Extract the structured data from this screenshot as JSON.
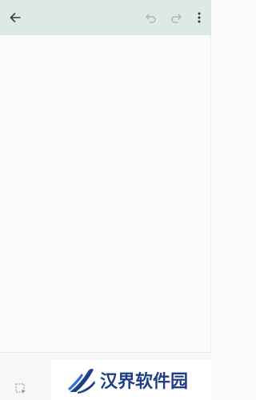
{
  "toolbar": {
    "background": "#dde9e4",
    "back_icon": "arrow-left-icon",
    "undo_icon": "undo-icon",
    "redo_icon": "redo-icon",
    "more_icon": "more-vertical-icon",
    "undo_enabled": false,
    "redo_enabled": false
  },
  "canvas": {
    "background": "#fbfbfb"
  },
  "bottom_bar": {
    "select_icon": "selection-tool-icon"
  },
  "watermark": {
    "text": "汉界软件园",
    "text_color": "#1f3f86",
    "logo_icon": "brand-logo-icon"
  }
}
